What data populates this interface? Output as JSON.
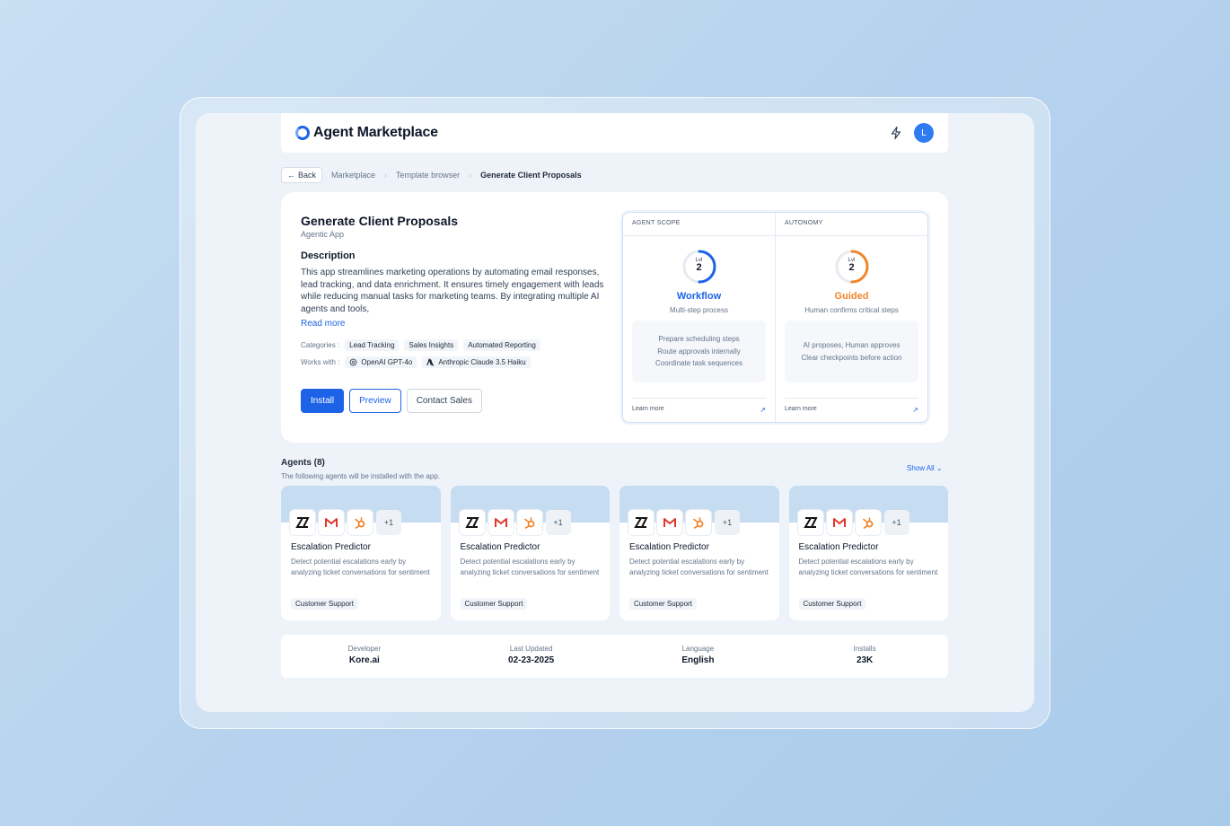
{
  "header": {
    "app_title": "Agent Marketplace",
    "avatar_initial": "L"
  },
  "breadcrumb": {
    "back_label": "Back",
    "items": [
      "Marketplace",
      "Template browser",
      "Generate Client Proposals"
    ]
  },
  "app": {
    "title": "Generate Client Proposals",
    "subtitle": "Agentic App",
    "description_heading": "Description",
    "description": "This app streamlines marketing operations by automating email responses, lead tracking, and data enrichment. It ensures timely engagement with leads while reducing manual tasks for marketing teams. By integrating multiple AI agents and tools,",
    "read_more": "Read more",
    "categories_label": "Categories :",
    "categories": [
      "Lead Tracking",
      "Sales Insights",
      "Automated Reporting"
    ],
    "works_with_label": "Works with :",
    "works_with": [
      "OpenAI GPT-4o",
      "Anthropic Claude 3.5 Haiku"
    ],
    "install_label": "Install",
    "preview_label": "Preview",
    "contact_label": "Contact Sales"
  },
  "scope": {
    "agent_scope": {
      "heading": "AGENT SCOPE",
      "lvl_label": "Lvl",
      "level": "2",
      "level_fraction": 0.5,
      "name": "Workflow",
      "desc": "Multi-step process",
      "lines": [
        "Prepare scheduling steps",
        "Route approvals internally",
        "Coordinate task sequences"
      ],
      "learn_more": "Learn more",
      "color": "#1d63e8"
    },
    "autonomy": {
      "heading": "AUTONOMY",
      "lvl_label": "Lvl",
      "level": "2",
      "level_fraction": 0.5,
      "name": "Guided",
      "desc": "Human confirms critical steps",
      "lines": [
        "AI proposes, Human approves",
        "Clear checkpoints before action"
      ],
      "learn_more": "Learn more",
      "color": "#f0862c"
    }
  },
  "agents": {
    "heading": "Agents (8)",
    "subheading": "The following agents will be installed with the app.",
    "show_all": "Show All",
    "items": [
      {
        "name": "Escalation Predictor",
        "desc1": "Detect potential escalations early by",
        "desc2": "analyzing ticket conversations for sentiment",
        "tag": "Customer Support",
        "more": "+1"
      },
      {
        "name": "Escalation Predictor",
        "desc1": "Detect potential escalations early by",
        "desc2": "analyzing ticket conversations for sentiment",
        "tag": "Customer Support",
        "more": "+1"
      },
      {
        "name": "Escalation Predictor",
        "desc1": "Detect potential escalations early by",
        "desc2": "analyzing ticket conversations for sentiment",
        "tag": "Customer Support",
        "more": "+1"
      },
      {
        "name": "Escalation Predictor",
        "desc1": "Detect potential escalations early by",
        "desc2": "analyzing ticket conversations for sentiment",
        "tag": "Customer Support",
        "more": "+1"
      }
    ]
  },
  "info": {
    "developer_label": "Developer",
    "developer": "Kore.ai",
    "updated_label": "Last Updated",
    "updated": "02-23-2025",
    "language_label": "Language",
    "language": "English",
    "installs_label": "Installs",
    "installs": "23K"
  },
  "icons": {
    "agent_icons": [
      "zendesk-icon",
      "gmail-icon",
      "hubspot-icon"
    ]
  }
}
